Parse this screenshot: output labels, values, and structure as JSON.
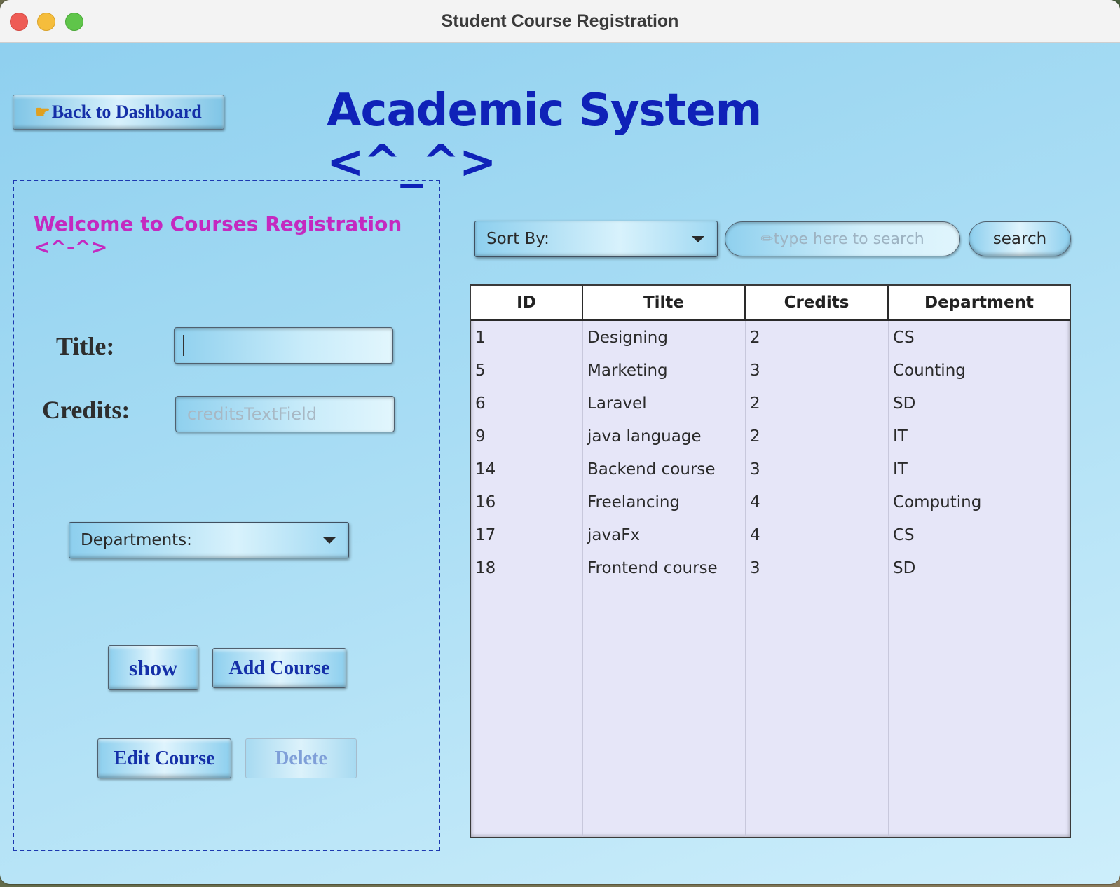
{
  "window": {
    "title": "Student Course Registration"
  },
  "header": {
    "back_button_label": "Back to Dashboard",
    "back_icon": "pointing-hand-icon",
    "app_title": "Academic System <^_^>"
  },
  "form": {
    "welcome": "Welcome to Courses Registration <^-^>",
    "title_label": "Title:",
    "title_value": "",
    "credits_label": "Credits:",
    "credits_placeholder": "creditsTextField",
    "department_combo_label": "Departments:",
    "buttons": {
      "show": "show",
      "add": "Add Course",
      "edit": "Edit Course",
      "delete": "Delete"
    }
  },
  "toolbar": {
    "sort_label": "Sort By:",
    "search_placeholder": "✏type here to search",
    "search_button": "search"
  },
  "table": {
    "columns": [
      "ID",
      "Tilte",
      "Credits",
      "Department"
    ],
    "rows": [
      [
        "1",
        "Designing",
        "2",
        "CS"
      ],
      [
        "5",
        "Marketing",
        "3",
        "Counting"
      ],
      [
        "6",
        "Laravel",
        "2",
        "SD"
      ],
      [
        "9",
        "java language",
        "2",
        "IT"
      ],
      [
        "14",
        "Backend course",
        "3",
        "IT"
      ],
      [
        "16",
        "Freelancing",
        "4",
        "Computing"
      ],
      [
        "17",
        "javaFx",
        "4",
        "CS"
      ],
      [
        "18",
        "Frontend course",
        "3",
        "SD"
      ]
    ]
  },
  "colors": {
    "accent": "#0f22b8",
    "welcome": "#c429c0",
    "background": "#a9ddf4",
    "table_bg": "#e6e6f8"
  }
}
